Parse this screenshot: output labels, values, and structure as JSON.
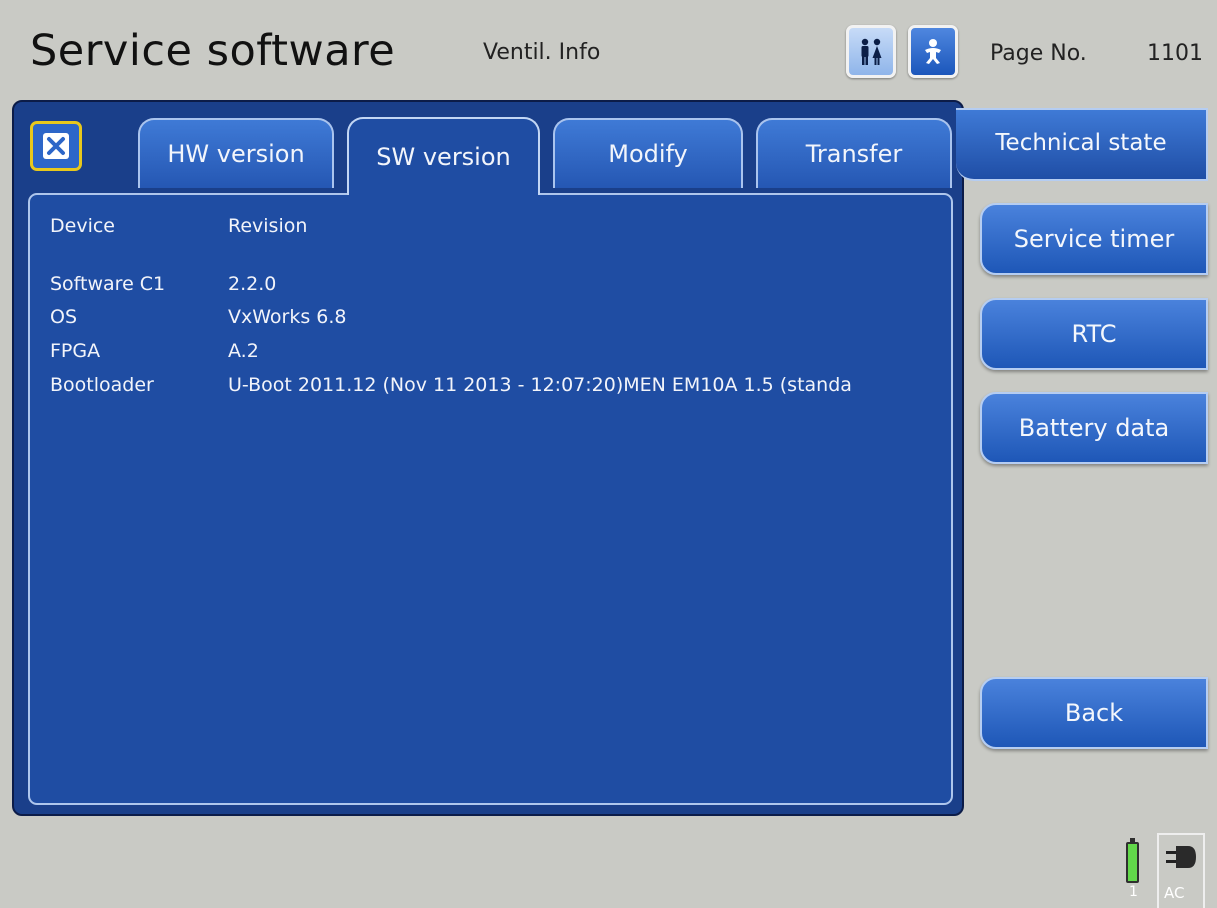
{
  "header": {
    "title": "Service software",
    "screen": "Ventil. Info",
    "page_label": "Page No.",
    "page_number": "1101",
    "mode_buttons": [
      {
        "name": "adult-patient-icon",
        "selected": true
      },
      {
        "name": "neonatal-patient-icon",
        "selected": false
      }
    ]
  },
  "tabs": [
    {
      "label": "HW version",
      "active": false
    },
    {
      "label": "SW version",
      "active": true
    },
    {
      "label": "Modify",
      "active": false
    },
    {
      "label": "Transfer",
      "active": false
    }
  ],
  "table": {
    "headers": {
      "device": "Device",
      "revision": "Revision"
    },
    "rows": [
      {
        "device": "Software C1",
        "revision": "2.2.0"
      },
      {
        "device": "OS",
        "revision": "VxWorks 6.8"
      },
      {
        "device": "FPGA",
        "revision": "A.2"
      },
      {
        "device": "Bootloader",
        "revision": "U-Boot 2011.12 (Nov 11 2013 - 12:07:20)MEN EM10A 1.5 (standa"
      }
    ]
  },
  "sidebar": {
    "tech_tab": "Technical state",
    "buttons": [
      "Service timer",
      "RTC",
      "Battery data"
    ],
    "back": "Back"
  },
  "status": {
    "battery_number": "1",
    "power_source": "AC",
    "colors": {
      "battery_fill": "#62d84a"
    }
  },
  "colors": {
    "panel": "#1a3f8a",
    "button": "#2d66c8",
    "close_border": "#e8c81c",
    "background": "#c9cac5"
  }
}
